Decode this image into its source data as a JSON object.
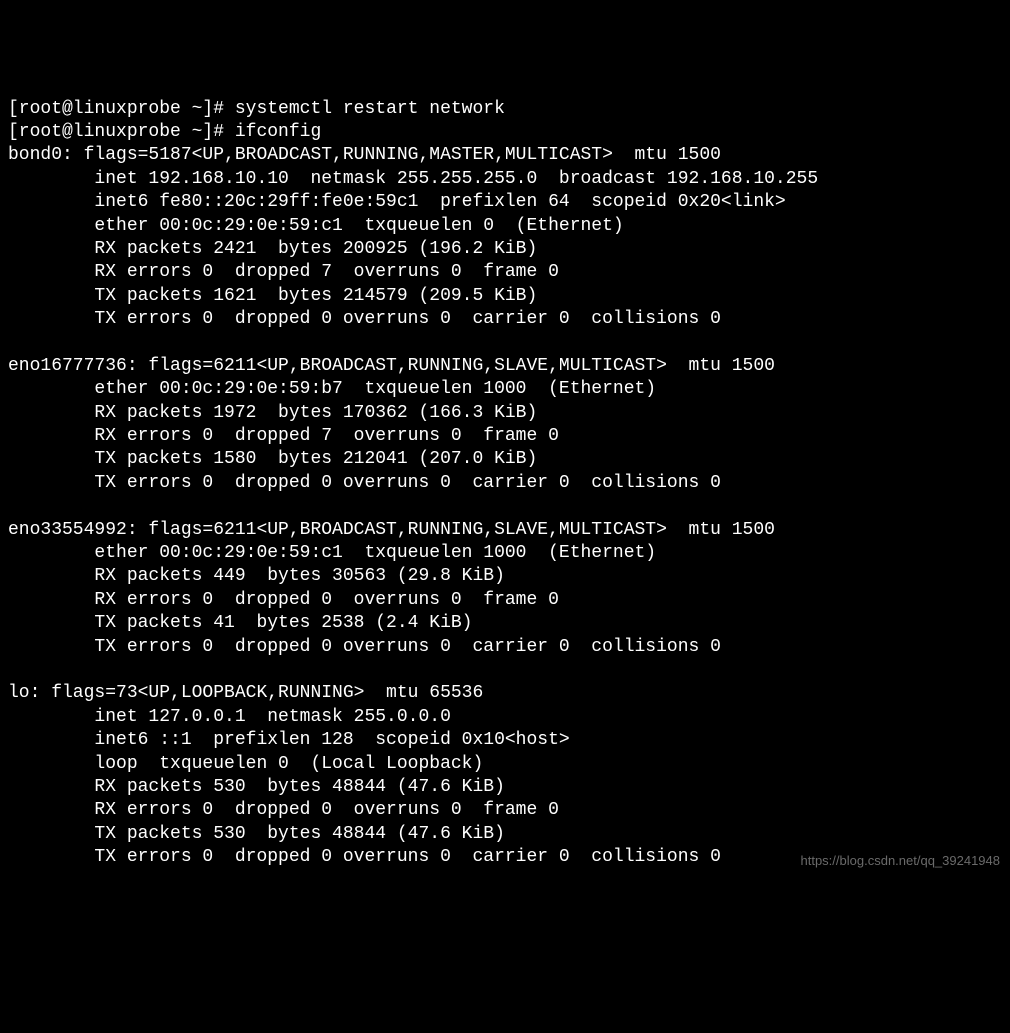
{
  "prompt1": "[root@linuxprobe ~]# ",
  "cmd1": "systemctl restart network",
  "prompt2": "[root@linuxprobe ~]# ",
  "cmd2": "ifconfig",
  "interfaces": {
    "bond0": {
      "header": "bond0: flags=5187<UP,BROADCAST,RUNNING,MASTER,MULTICAST>  mtu 1500",
      "inet": "        inet 192.168.10.10  netmask 255.255.255.0  broadcast 192.168.10.255",
      "inet6": "        inet6 fe80::20c:29ff:fe0e:59c1  prefixlen 64  scopeid 0x20<link>",
      "ether": "        ether 00:0c:29:0e:59:c1  txqueuelen 0  (Ethernet)",
      "rxp": "        RX packets 2421  bytes 200925 (196.2 KiB)",
      "rxe": "        RX errors 0  dropped 7  overruns 0  frame 0",
      "txp": "        TX packets 1621  bytes 214579 (209.5 KiB)",
      "txe": "        TX errors 0  dropped 0 overruns 0  carrier 0  collisions 0"
    },
    "eno1": {
      "header": "eno16777736: flags=6211<UP,BROADCAST,RUNNING,SLAVE,MULTICAST>  mtu 1500",
      "ether": "        ether 00:0c:29:0e:59:b7  txqueuelen 1000  (Ethernet)",
      "rxp": "        RX packets 1972  bytes 170362 (166.3 KiB)",
      "rxe": "        RX errors 0  dropped 7  overruns 0  frame 0",
      "txp": "        TX packets 1580  bytes 212041 (207.0 KiB)",
      "txe": "        TX errors 0  dropped 0 overruns 0  carrier 0  collisions 0"
    },
    "eno2": {
      "header": "eno33554992: flags=6211<UP,BROADCAST,RUNNING,SLAVE,MULTICAST>  mtu 1500",
      "ether": "        ether 00:0c:29:0e:59:c1  txqueuelen 1000  (Ethernet)",
      "rxp": "        RX packets 449  bytes 30563 (29.8 KiB)",
      "rxe": "        RX errors 0  dropped 0  overruns 0  frame 0",
      "txp": "        TX packets 41  bytes 2538 (2.4 KiB)",
      "txe": "        TX errors 0  dropped 0 overruns 0  carrier 0  collisions 0"
    },
    "lo": {
      "header": "lo: flags=73<UP,LOOPBACK,RUNNING>  mtu 65536",
      "inet": "        inet 127.0.0.1  netmask 255.0.0.0",
      "inet6": "        inet6 ::1  prefixlen 128  scopeid 0x10<host>",
      "loop": "        loop  txqueuelen 0  (Local Loopback)",
      "rxp": "        RX packets 530  bytes 48844 (47.6 KiB)",
      "rxe": "        RX errors 0  dropped 0  overruns 0  frame 0",
      "txp": "        TX packets 530  bytes 48844 (47.6 KiB)",
      "txe": "        TX errors 0  dropped 0 overruns 0  carrier 0  collisions 0"
    }
  },
  "watermark": "https://blog.csdn.net/qq_39241948"
}
